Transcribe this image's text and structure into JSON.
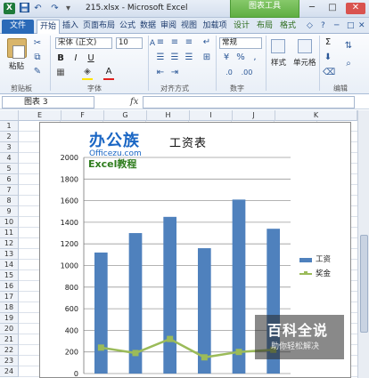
{
  "window": {
    "title": "215.xlsx - Microsoft Excel",
    "context_tab": "图表工具",
    "logo_letter": "X",
    "minimize_glyph": "─",
    "maximize_glyph": "□",
    "close_glyph": "✕"
  },
  "tabs": [
    "文件",
    "开始",
    "插入",
    "页面布局",
    "公式",
    "数据",
    "审阅",
    "视图",
    "加载项",
    "设计",
    "布局",
    "格式"
  ],
  "ribbon": {
    "paste_label": "粘贴",
    "font_name": "宋体 (正文)",
    "font_size": "10",
    "number_format": "常规",
    "style_label": "样式",
    "cells_label": "单元格",
    "sum_glyph": "Σ",
    "groups": {
      "clipboard": "剪贴板",
      "font": "字体",
      "alignment": "对齐方式",
      "number": "数字",
      "editing": "编辑"
    },
    "bold": "B",
    "italic": "I",
    "underline": "U",
    "font_color_glyph": "A",
    "percent": "%",
    "comma": ","
  },
  "formula_bar": {
    "name_box": "图表 3",
    "fx": "fx",
    "value": ""
  },
  "columns": [
    "E",
    "F",
    "G",
    "H",
    "I",
    "J",
    "K"
  ],
  "rows": [
    "1",
    "2",
    "3",
    "4",
    "5",
    "6",
    "7",
    "8",
    "9",
    "10",
    "11",
    "12",
    "13",
    "14",
    "15",
    "16",
    "17",
    "18",
    "19",
    "20",
    "21",
    "22",
    "23",
    "24"
  ],
  "brand": {
    "main": "办公族",
    "sub": "Officezu.com",
    "badge": "Excel教程"
  },
  "watermark": {
    "title": "百科全说",
    "subtitle": "助你轻松解决"
  },
  "colors": {
    "bar": "#4f81bd",
    "line": "#9bbb59",
    "chart_tools_tab": "#5fae43",
    "file_tab": "#2a6ab8"
  },
  "chart_data": {
    "type": "bar",
    "title": "工资表",
    "xlabel": "",
    "ylabel": "",
    "ylim": [
      0,
      2000
    ],
    "yticks": [
      0,
      200,
      400,
      600,
      800,
      1000,
      1200,
      1400,
      1600,
      1800,
      2000
    ],
    "categories": [
      "",
      "",
      "",
      "",
      "",
      ""
    ],
    "grid": true,
    "legend_position": "right",
    "series": [
      {
        "name": "工资",
        "kind": "bar",
        "values": [
          1120,
          1300,
          1450,
          1160,
          1610,
          1340
        ]
      },
      {
        "name": "奖金",
        "kind": "line",
        "values": [
          240,
          190,
          320,
          150,
          200,
          220
        ]
      }
    ]
  }
}
